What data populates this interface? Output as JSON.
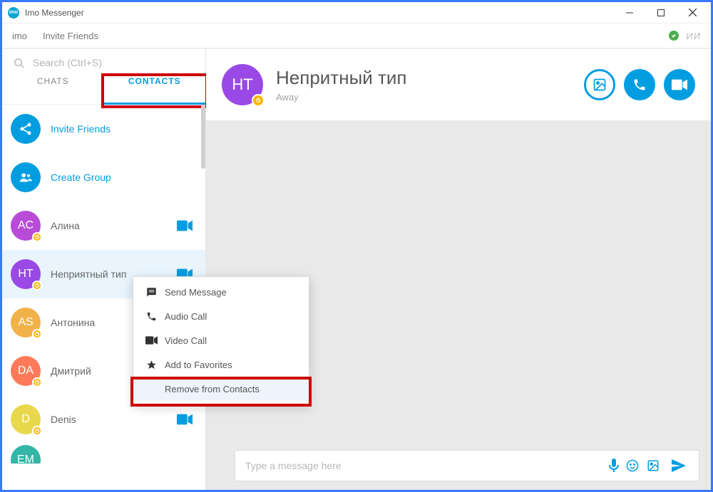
{
  "window": {
    "title": "Imo Messenger"
  },
  "toolbar": {
    "app_label": "imo",
    "invite_label": "Invite Friends",
    "user_initials": "ИИ"
  },
  "search": {
    "placeholder": "Search (Ctrl+S)"
  },
  "tabs": {
    "chats": "CHATS",
    "contacts": "CONTACTS"
  },
  "sidebar": {
    "invite": "Invite Friends",
    "create_group": "Create Group",
    "contacts": [
      {
        "initials": "AC",
        "name": "Алина",
        "color": "#b84bd8",
        "video": true,
        "presence": true
      },
      {
        "initials": "HT",
        "name": "Неприятный тип",
        "color": "#9a49e6",
        "video": true,
        "presence": true,
        "selected": true
      },
      {
        "initials": "AS",
        "name": "Антонина",
        "color": "#f2b24a",
        "video": false,
        "presence": true
      },
      {
        "initials": "DA",
        "name": "Дмитрий",
        "color": "#ff7a59",
        "video": false,
        "presence": true
      },
      {
        "initials": "D",
        "name": "Denis",
        "color": "#e9d84b",
        "video": true,
        "presence": true
      },
      {
        "initials": "EM",
        "name": "",
        "color": "#33b6a7",
        "video": false,
        "presence": false
      }
    ]
  },
  "chat": {
    "avatar_initials": "HT",
    "avatar_color": "#9a49e6",
    "name": "Непритный тип",
    "status": "Away",
    "compose_placeholder": "Type a message here"
  },
  "context_menu": {
    "send_message": "Send Message",
    "audio_call": "Audio Call",
    "video_call": "Video Call",
    "add_favorites": "Add to Favorites",
    "remove_contacts": "Remove from Contacts"
  }
}
